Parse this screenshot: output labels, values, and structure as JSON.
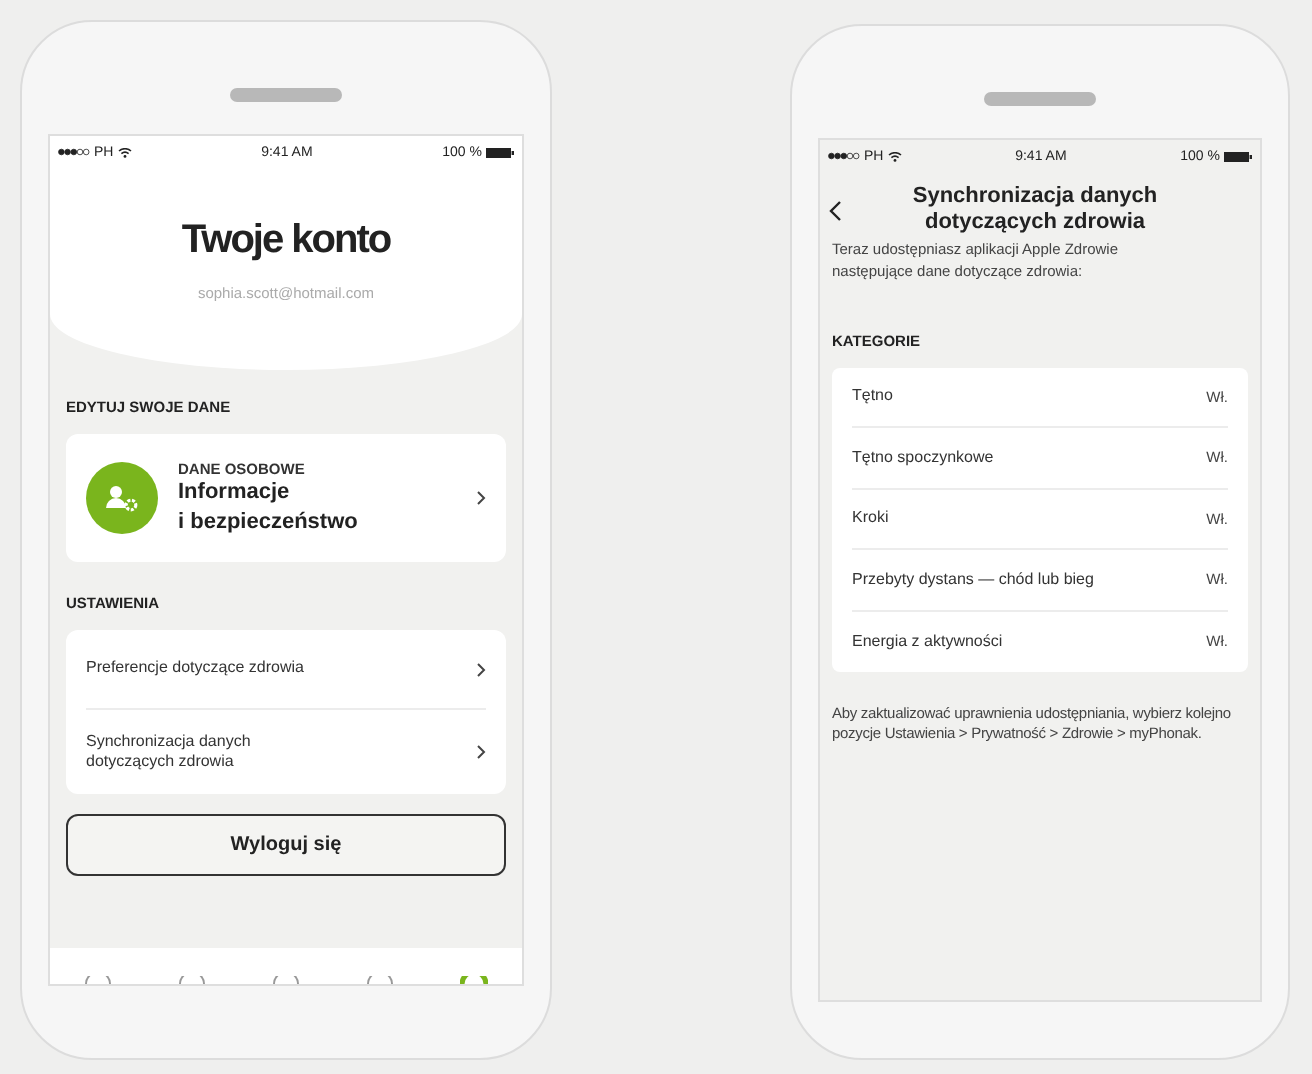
{
  "account_screen": {
    "status_bar": {
      "carrier": "PH",
      "time": "9:41 AM",
      "battery": "100 %"
    },
    "title": "Twoje konto",
    "email": "sophia.scott@hotmail.com",
    "edit_section": {
      "heading": "EDYTUJ SWOJE DANE",
      "card": {
        "overline": "DANE OSOBOWE",
        "title": "Informacje\ni bezpieczeństwo"
      }
    },
    "settings_section": {
      "heading": "USTAWIENIA",
      "items": [
        {
          "label": "Preferencje dotyczące zdrowia"
        },
        {
          "label": "Synchronizacja danych\ndotyczących zdrowia"
        }
      ]
    },
    "logout_button": "Wyloguj się",
    "tab_bar": {
      "items": [
        {
          "selected": false
        },
        {
          "selected": false
        },
        {
          "selected": false
        },
        {
          "selected": false
        },
        {
          "selected": true
        }
      ]
    }
  },
  "health_sync_screen": {
    "status_bar": {
      "carrier": "PH",
      "time": "9:41 AM",
      "battery": "100 %"
    },
    "title": "Synchronizacja danych\ndotyczących zdrowia",
    "description": "Teraz udostępniasz aplikacji Apple Zdrowie następujące dane dotyczące zdrowia:",
    "categories_heading": "KATEGORIE",
    "categories": [
      {
        "label": "Tętno",
        "value": "Wł."
      },
      {
        "label": "Tętno spoczynkowe",
        "value": "Wł."
      },
      {
        "label": "Kroki",
        "value": "Wł."
      },
      {
        "label": "Przebyty dystans — chód lub bieg",
        "value": "Wł."
      },
      {
        "label": "Energia z aktywności",
        "value": "Wł."
      }
    ],
    "footer": "Aby zaktualizować uprawnienia udostępniania, wybierz kolejno pozycje Ustawienia > Prywatność > Zdrowie > myPhonak."
  }
}
